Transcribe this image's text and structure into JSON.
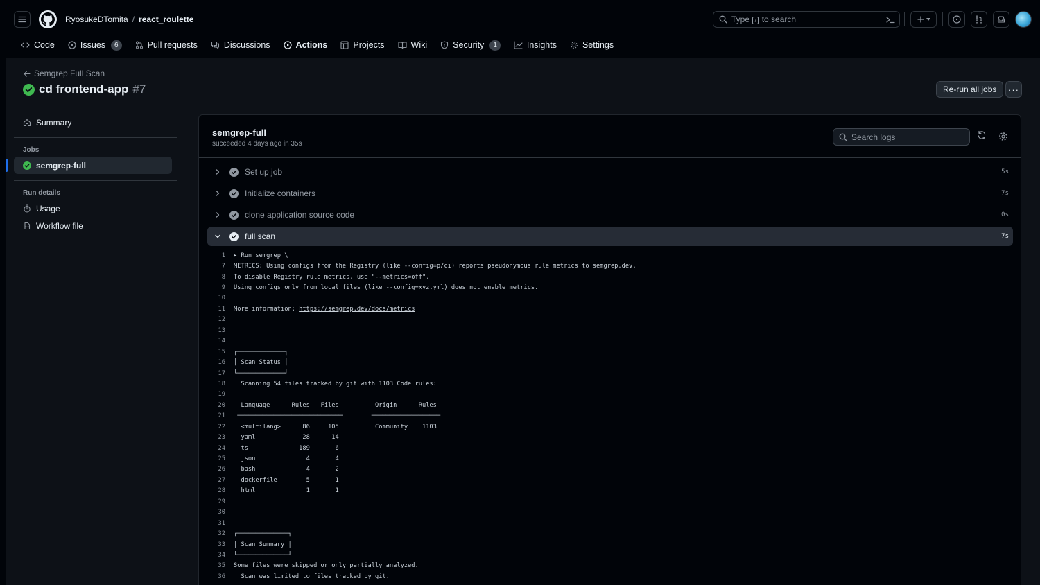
{
  "header": {
    "owner": "RyosukeDTomita",
    "separator": "/",
    "repo": "react_roulette",
    "search_prefix": "Type",
    "search_key": "/",
    "search_suffix": "to search"
  },
  "tabs": [
    {
      "label": "Code",
      "icon": "code-icon"
    },
    {
      "label": "Issues",
      "icon": "issue-icon",
      "count": "6"
    },
    {
      "label": "Pull requests",
      "icon": "pull-request-icon"
    },
    {
      "label": "Discussions",
      "icon": "discussions-icon"
    },
    {
      "label": "Actions",
      "icon": "play-icon",
      "active": true
    },
    {
      "label": "Projects",
      "icon": "table-icon"
    },
    {
      "label": "Wiki",
      "icon": "book-icon"
    },
    {
      "label": "Security",
      "icon": "shield-icon",
      "count": "1"
    },
    {
      "label": "Insights",
      "icon": "graph-icon"
    },
    {
      "label": "Settings",
      "icon": "gear-icon"
    }
  ],
  "run": {
    "back_label": "Semgrep Full Scan",
    "title": "cd frontend-app",
    "number": "#7",
    "rerun_label": "Re-run all jobs",
    "more_label": "···"
  },
  "sidebar": {
    "summary": "Summary",
    "jobs_heading": "Jobs",
    "job": "semgrep-full",
    "run_details_heading": "Run details",
    "usage": "Usage",
    "workflow_file": "Workflow file"
  },
  "job": {
    "name": "semgrep-full",
    "status": "succeeded 4 days ago in 35s",
    "search_placeholder": "Search logs"
  },
  "steps": [
    {
      "label": "Set up job",
      "duration": "5s",
      "open": false
    },
    {
      "label": "Initialize containers",
      "duration": "7s",
      "open": false
    },
    {
      "label": "clone application source code",
      "duration": "0s",
      "open": false
    },
    {
      "label": "full scan",
      "duration": "7s",
      "open": true
    }
  ],
  "log_lines": [
    {
      "no": "1",
      "text": "▸ Run semgrep \\"
    },
    {
      "no": "7",
      "text": "METRICS: Using configs from the Registry (like --config=p/ci) reports pseudonymous rule metrics to semgrep.dev."
    },
    {
      "no": "8",
      "text": "To disable Registry rule metrics, use \"--metrics=off\"."
    },
    {
      "no": "9",
      "text": "Using configs only from local files (like --config=xyz.yml) does not enable metrics."
    },
    {
      "no": "10",
      "text": ""
    },
    {
      "no": "11",
      "text": "More information: ",
      "link": "https://semgrep.dev/docs/metrics"
    },
    {
      "no": "12",
      "text": ""
    },
    {
      "no": "13",
      "text": ""
    },
    {
      "no": "14",
      "text": ""
    },
    {
      "no": "15",
      "text": "┌─────────────┐"
    },
    {
      "no": "16",
      "text": "│ Scan Status │"
    },
    {
      "no": "17",
      "text": "└─────────────┘"
    },
    {
      "no": "18",
      "text": "  Scanning 54 files tracked by git with 1103 Code rules:"
    },
    {
      "no": "19",
      "text": ""
    },
    {
      "no": "20",
      "text": "  Language      Rules   Files          Origin      Rules"
    },
    {
      "no": "21",
      "text": " ─────────────────────────────        ───────────────────"
    },
    {
      "no": "22",
      "text": "  <multilang>      86     105          Community    1103"
    },
    {
      "no": "23",
      "text": "  yaml             28      14"
    },
    {
      "no": "24",
      "text": "  ts              189       6"
    },
    {
      "no": "25",
      "text": "  json              4       4"
    },
    {
      "no": "26",
      "text": "  bash              4       2"
    },
    {
      "no": "27",
      "text": "  dockerfile        5       1"
    },
    {
      "no": "28",
      "text": "  html              1       1"
    },
    {
      "no": "29",
      "text": ""
    },
    {
      "no": "30",
      "text": ""
    },
    {
      "no": "31",
      "text": ""
    },
    {
      "no": "32",
      "text": "┌──────────────┐"
    },
    {
      "no": "33",
      "text": "│ Scan Summary │"
    },
    {
      "no": "34",
      "text": "└──────────────┘"
    },
    {
      "no": "35",
      "text": "Some files were skipped or only partially analyzed."
    },
    {
      "no": "36",
      "text": "  Scan was limited to files tracked by git."
    }
  ],
  "colors": {
    "success": "#3fb950",
    "accent_underline": "#f78166",
    "selected_bar": "#1f6feb"
  }
}
